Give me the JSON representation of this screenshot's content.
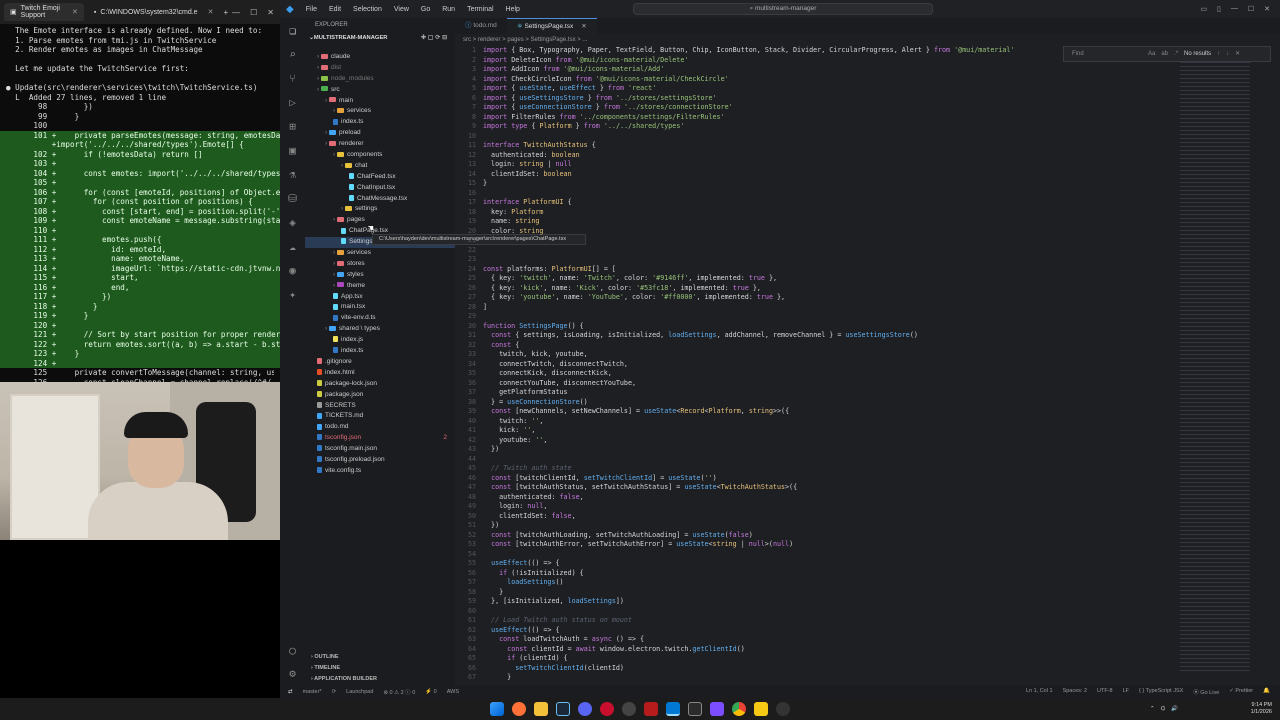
{
  "terminal": {
    "tabs": [
      {
        "label": "Twitch Emoji Support"
      },
      {
        "label": "C:\\WINDOWS\\system32\\cmd.e"
      }
    ],
    "plus": "+",
    "lines": [
      {
        "text": "  The Emote interface is already defined. Now I need to:",
        "style": ""
      },
      {
        "text": "  1. Parse emotes from tmi.js in TwitchService",
        "style": ""
      },
      {
        "text": "  2. Render emotes as images in ChatMessage",
        "style": ""
      },
      {
        "text": "",
        "style": ""
      },
      {
        "text": "  Let me update the TwitchService first:",
        "style": ""
      },
      {
        "text": "",
        "style": ""
      },
      {
        "text": "● Update(src\\renderer\\services\\twitch\\TwitchService.ts)",
        "style": ""
      },
      {
        "text": "  L  Added 27 lines, removed 1 line",
        "style": ""
      },
      {
        "text": "       98        })",
        "style": ""
      },
      {
        "text": "       99      }",
        "style": ""
      },
      {
        "text": "      100",
        "style": ""
      },
      {
        "text": "      101 +    private parseEmotes(message: string, emotesDat",
        "style": "green"
      },
      {
        "text": "          +import('../../../shared/types').Emote[] {",
        "style": "green"
      },
      {
        "text": "      102 +      if (!emotesData) return []",
        "style": "green"
      },
      {
        "text": "      103 +",
        "style": "green"
      },
      {
        "text": "      104 +      const emotes: import('../../../shared/types'",
        "style": "green"
      },
      {
        "text": "      105 +",
        "style": "green"
      },
      {
        "text": "      106 +      for (const [emoteId, positions] of Object.en",
        "style": "green"
      },
      {
        "text": "      107 +        for (const position of positions) {",
        "style": "green"
      },
      {
        "text": "      108 +          const [start, end] = position.split('-')",
        "style": "green"
      },
      {
        "text": "      109 +          const emoteName = message.substring(star",
        "style": "green"
      },
      {
        "text": "      110 +",
        "style": "green"
      },
      {
        "text": "      111 +          emotes.push({",
        "style": "green"
      },
      {
        "text": "      112 +            id: emoteId,",
        "style": "green"
      },
      {
        "text": "      113 +            name: emoteName,",
        "style": "green"
      },
      {
        "text": "      114 +            imageUrl: `https://static-cdn.jtvnw.ne",
        "style": "green"
      },
      {
        "text": "      115 +            start,",
        "style": "green"
      },
      {
        "text": "      116 +            end,",
        "style": "green"
      },
      {
        "text": "      117 +          })",
        "style": "green"
      },
      {
        "text": "      118 +        }",
        "style": "green"
      },
      {
        "text": "      119 +      }",
        "style": "green"
      },
      {
        "text": "      120 +",
        "style": "green"
      },
      {
        "text": "      121 +      // Sort by start position for proper renderi",
        "style": "green"
      },
      {
        "text": "      122 +      return emotes.sort((a, b) => a.start - b.sta",
        "style": "green"
      },
      {
        "text": "      123 +    }",
        "style": "green"
      },
      {
        "text": "      124 +",
        "style": "green"
      },
      {
        "text": "      125      private convertToMessage(channel: string, user",
        "style": ""
      },
      {
        "text": "      126        const cleanChannel = channel.replace(/^#/, '",
        "style": ""
      }
    ]
  },
  "vscode": {
    "menu": [
      "File",
      "Edit",
      "Selection",
      "View",
      "Go",
      "Run",
      "Terminal",
      "Help"
    ],
    "command_center": "multistream-manager",
    "explorer_label": "EXPLORER",
    "project_label": "MULTISTREAM-MANAGER",
    "tree": [
      {
        "label": "claude",
        "depth": 1,
        "kind": "folder",
        "color": "#e06c75"
      },
      {
        "label": "dist",
        "depth": 1,
        "kind": "folder",
        "color": "#e06c75",
        "dim": true
      },
      {
        "label": "node_modules",
        "depth": 1,
        "kind": "folder",
        "color": "#8bc34a",
        "dim": true
      },
      {
        "label": "src",
        "depth": 1,
        "kind": "folder",
        "color": "#4caf50"
      },
      {
        "label": "main",
        "depth": 2,
        "kind": "folder",
        "color": "#e06c75"
      },
      {
        "label": "services",
        "depth": 3,
        "kind": "folder",
        "color": "#e6a23c"
      },
      {
        "label": "index.ts",
        "depth": 3,
        "kind": "file",
        "color": "#3178c6"
      },
      {
        "label": "preload",
        "depth": 2,
        "kind": "folder",
        "color": "#42a5f5"
      },
      {
        "label": "renderer",
        "depth": 2,
        "kind": "folder",
        "color": "#e06c75"
      },
      {
        "label": "components",
        "depth": 3,
        "kind": "folder",
        "color": "#e6c23c"
      },
      {
        "label": "chat",
        "depth": 4,
        "kind": "folder",
        "color": "#e6c23c"
      },
      {
        "label": "ChatFeed.tsx",
        "depth": 5,
        "kind": "file",
        "color": "#61dafb"
      },
      {
        "label": "ChatInput.tsx",
        "depth": 5,
        "kind": "file",
        "color": "#61dafb"
      },
      {
        "label": "ChatMessage.tsx",
        "depth": 5,
        "kind": "file",
        "color": "#61dafb"
      },
      {
        "label": "settings",
        "depth": 4,
        "kind": "folder",
        "color": "#e6c23c"
      },
      {
        "label": "pages",
        "depth": 3,
        "kind": "folder",
        "color": "#e06c75"
      },
      {
        "label": "ChatPage.tsx",
        "depth": 4,
        "kind": "file",
        "color": "#61dafb"
      },
      {
        "label": "SettingsPag",
        "depth": 4,
        "kind": "file",
        "color": "#61dafb",
        "selected": true
      },
      {
        "label": "services",
        "depth": 3,
        "kind": "folder",
        "color": "#e6a23c"
      },
      {
        "label": "stores",
        "depth": 3,
        "kind": "folder",
        "color": "#e06c75"
      },
      {
        "label": "styles",
        "depth": 3,
        "kind": "folder",
        "color": "#42a5f5"
      },
      {
        "label": "theme",
        "depth": 3,
        "kind": "folder",
        "color": "#ab47bc"
      },
      {
        "label": "App.tsx",
        "depth": 3,
        "kind": "file",
        "color": "#61dafb"
      },
      {
        "label": "main.tsx",
        "depth": 3,
        "kind": "file",
        "color": "#61dafb"
      },
      {
        "label": "vite-env.d.ts",
        "depth": 3,
        "kind": "file",
        "color": "#3178c6"
      },
      {
        "label": "shared \\ types",
        "depth": 2,
        "kind": "folder",
        "color": "#42a5f5"
      },
      {
        "label": "index.js",
        "depth": 3,
        "kind": "file",
        "color": "#f1e05a"
      },
      {
        "label": "index.ts",
        "depth": 3,
        "kind": "file",
        "color": "#3178c6"
      },
      {
        "label": ".gitignore",
        "depth": 1,
        "kind": "file",
        "color": "#e06c75"
      },
      {
        "label": "index.html",
        "depth": 1,
        "kind": "file",
        "color": "#e44d26"
      },
      {
        "label": "package-lock.json",
        "depth": 1,
        "kind": "file",
        "color": "#cbcb41"
      },
      {
        "label": "package.json",
        "depth": 1,
        "kind": "file",
        "color": "#cbcb41"
      },
      {
        "label": "SECRETS",
        "depth": 1,
        "kind": "file",
        "color": "#999999"
      },
      {
        "label": "TICKETS.md",
        "depth": 1,
        "kind": "file",
        "color": "#42a5f5"
      },
      {
        "label": "todo.md",
        "depth": 1,
        "kind": "file",
        "color": "#42a5f5"
      },
      {
        "label": "tsconfig.json",
        "depth": 1,
        "kind": "file",
        "color": "#3178c6",
        "red": true,
        "badge": "2"
      },
      {
        "label": "tsconfig.main.json",
        "depth": 1,
        "kind": "file",
        "color": "#3178c6"
      },
      {
        "label": "tsconfig.preload.json",
        "depth": 1,
        "kind": "file",
        "color": "#3178c6"
      },
      {
        "label": "vite.config.ts",
        "depth": 1,
        "kind": "file",
        "color": "#3178c6"
      }
    ],
    "panels": [
      "OUTLINE",
      "TIMELINE",
      "APPLICATION BUILDER"
    ],
    "tooltip": "C:\\Users\\hayden\\dev\\multistream-manager\\src\\renderer\\pages\\ChatPage.tsx",
    "tabs": [
      {
        "label": "todo.md",
        "active": false
      },
      {
        "label": "SettingsPage.tsx",
        "active": true
      }
    ],
    "breadcrumb": "src > renderer > pages > SettingsPage.tsx > ...",
    "find": {
      "placeholder": "Find",
      "aa": "Aa",
      "ab": "ab",
      "regex": ".*",
      "result": "No results"
    },
    "code": [
      {
        "n": "1",
        "t": "import { Box, Typography, Paper, TextField, Button, Chip, IconButton, Stack, Divider, CircularProgress, Alert } from '@mui/material'"
      },
      {
        "n": "2",
        "t": "import DeleteIcon from '@mui/icons-material/Delete'"
      },
      {
        "n": "3",
        "t": "import AddIcon from '@mui/icons-material/Add'"
      },
      {
        "n": "4",
        "t": "import CheckCircleIcon from '@mui/icons-material/CheckCircle'"
      },
      {
        "n": "5",
        "t": "import { useState, useEffect } from 'react'"
      },
      {
        "n": "6",
        "t": "import { useSettingsStore } from '../stores/settingsStore'"
      },
      {
        "n": "7",
        "t": "import { useConnectionStore } from '../stores/connectionStore'"
      },
      {
        "n": "8",
        "t": "import FilterRules from '../components/settings/FilterRules'"
      },
      {
        "n": "9",
        "t": "import type { Platform } from '../../shared/types'"
      },
      {
        "n": "10",
        "t": ""
      },
      {
        "n": "11",
        "t": "interface TwitchAuthStatus {"
      },
      {
        "n": "12",
        "t": "  authenticated: boolean"
      },
      {
        "n": "13",
        "t": "  login: string | null"
      },
      {
        "n": "14",
        "t": "  clientIdSet: boolean"
      },
      {
        "n": "15",
        "t": "}"
      },
      {
        "n": "16",
        "t": ""
      },
      {
        "n": "17",
        "t": "interface PlatformUI {"
      },
      {
        "n": "18",
        "t": "  key: Platform"
      },
      {
        "n": "19",
        "t": "  name: string"
      },
      {
        "n": "20",
        "t": "  color: string"
      },
      {
        "n": "21",
        "t": ""
      },
      {
        "n": "22",
        "t": ""
      },
      {
        "n": "23",
        "t": ""
      },
      {
        "n": "24",
        "t": "const platforms: PlatformUI[] = ["
      },
      {
        "n": "25",
        "t": "  { key: 'twitch', name: 'Twitch', color: '#9146ff', implemented: true },"
      },
      {
        "n": "26",
        "t": "  { key: 'kick', name: 'Kick', color: '#53fc18', implemented: true },"
      },
      {
        "n": "27",
        "t": "  { key: 'youtube', name: 'YouTube', color: '#ff0000', implemented: true },"
      },
      {
        "n": "28",
        "t": "]"
      },
      {
        "n": "29",
        "t": ""
      },
      {
        "n": "30",
        "t": "function SettingsPage() {"
      },
      {
        "n": "31",
        "t": "  const { settings, isLoading, isInitialized, loadSettings, addChannel, removeChannel } = useSettingsStore()"
      },
      {
        "n": "32",
        "t": "  const {"
      },
      {
        "n": "33",
        "t": "    twitch, kick, youtube,"
      },
      {
        "n": "34",
        "t": "    connectTwitch, disconnectTwitch,"
      },
      {
        "n": "35",
        "t": "    connectKick, disconnectKick,"
      },
      {
        "n": "36",
        "t": "    connectYouTube, disconnectYouTube,"
      },
      {
        "n": "37",
        "t": "    getPlatformStatus"
      },
      {
        "n": "38",
        "t": "  } = useConnectionStore()"
      },
      {
        "n": "39",
        "t": "  const [newChannels, setNewChannels] = useState<Record<Platform, string>>({"
      },
      {
        "n": "40",
        "t": "    twitch: '',"
      },
      {
        "n": "41",
        "t": "    kick: '',"
      },
      {
        "n": "42",
        "t": "    youtube: '',"
      },
      {
        "n": "43",
        "t": "  })"
      },
      {
        "n": "44",
        "t": ""
      },
      {
        "n": "45",
        "t": "  // Twitch auth state"
      },
      {
        "n": "46",
        "t": "  const [twitchClientId, setTwitchClientId] = useState('')"
      },
      {
        "n": "47",
        "t": "  const [twitchAuthStatus, setTwitchAuthStatus] = useState<TwitchAuthStatus>({"
      },
      {
        "n": "48",
        "t": "    authenticated: false,"
      },
      {
        "n": "49",
        "t": "    login: null,"
      },
      {
        "n": "50",
        "t": "    clientIdSet: false,"
      },
      {
        "n": "51",
        "t": "  })"
      },
      {
        "n": "52",
        "t": "  const [twitchAuthLoading, setTwitchAuthLoading] = useState(false)"
      },
      {
        "n": "53",
        "t": "  const [twitchAuthError, setTwitchAuthError] = useState<string | null>(null)"
      },
      {
        "n": "54",
        "t": ""
      },
      {
        "n": "55",
        "t": "  useEffect(() => {"
      },
      {
        "n": "56",
        "t": "    if (!isInitialized) {"
      },
      {
        "n": "57",
        "t": "      loadSettings()"
      },
      {
        "n": "58",
        "t": "    }"
      },
      {
        "n": "59",
        "t": "  }, [isInitialized, loadSettings])"
      },
      {
        "n": "60",
        "t": ""
      },
      {
        "n": "61",
        "t": "  // Load Twitch auth status on mount"
      },
      {
        "n": "62",
        "t": "  useEffect(() => {"
      },
      {
        "n": "63",
        "t": "    const loadTwitchAuth = async () => {"
      },
      {
        "n": "64",
        "t": "      const clientId = await window.electron.twitch.getClientId()"
      },
      {
        "n": "65",
        "t": "      if (clientId) {"
      },
      {
        "n": "66",
        "t": "        setTwitchClientId(clientId)"
      },
      {
        "n": "67",
        "t": "      }"
      }
    ],
    "status": {
      "branch": "master*",
      "sync": "⟳",
      "problems": "⊗ 0 ⚠ 2 ⓘ 0",
      "launchpad": "Launchpad",
      "ports": "⚡ 0",
      "aws": "AWS",
      "position": "Ln 1, Col 1",
      "spaces": "Spaces: 2",
      "encoding": "UTF-8",
      "eol": "LF",
      "language": "{ } TypeScript JSX",
      "golive": "⦿ Go Live",
      "prettier": "✓ Prettier"
    }
  },
  "taskbar": {
    "time": "9:14 PM",
    "date": "1/1/2026"
  }
}
